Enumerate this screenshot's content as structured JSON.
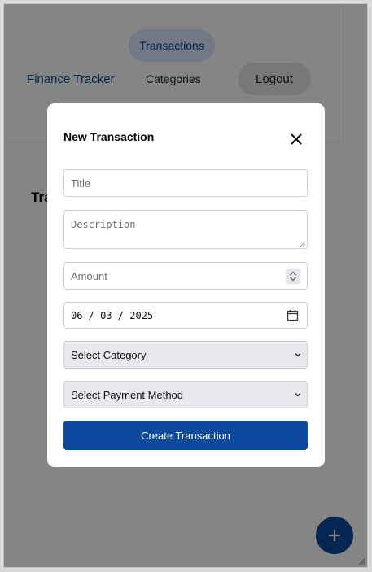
{
  "nav": {
    "brand": "Finance Tracker",
    "transactions": "Transactions",
    "categories": "Categories",
    "logout": "Logout"
  },
  "page": {
    "heading": "Tra"
  },
  "modal": {
    "title": "New Transaction",
    "title_placeholder": "Title",
    "description_placeholder": "Description",
    "amount_placeholder": "Amount",
    "date_value": "06 / 03 / 2025",
    "category_selected": "Select Category",
    "payment_selected": "Select Payment Method",
    "submit_label": "Create Transaction"
  },
  "icons": {
    "close": "close-icon",
    "calendar": "calendar-icon",
    "add": "plus-icon",
    "chevron": "chevron-down-icon"
  },
  "colors": {
    "primary": "#0b4a9c",
    "nav_active_bg": "#dbe7ff",
    "select_bg": "#e8e8ed"
  }
}
